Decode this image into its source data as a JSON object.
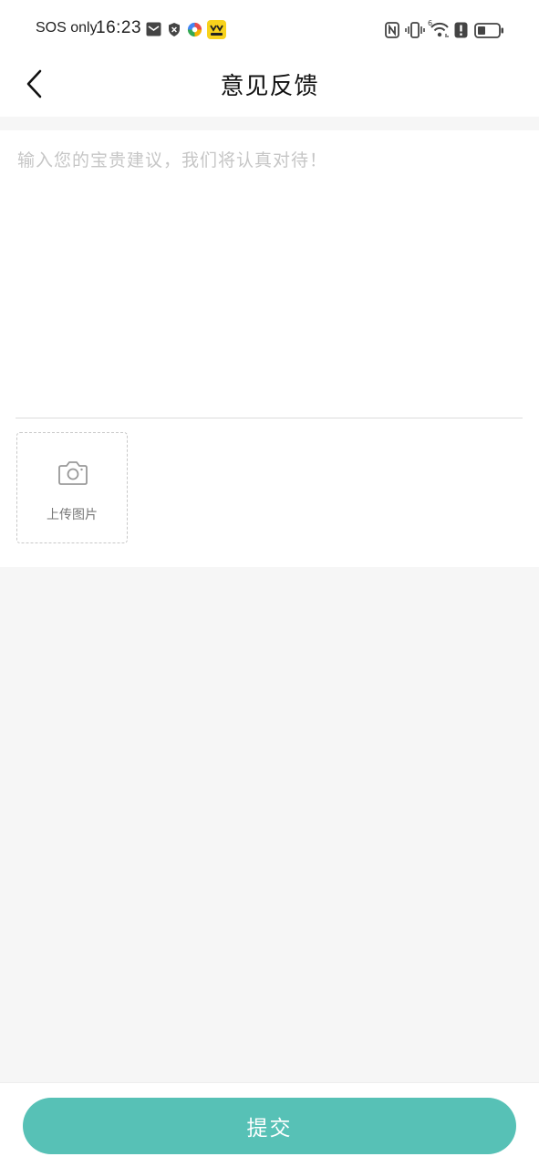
{
  "status_bar": {
    "carrier": "SOS only",
    "time": "16:23",
    "icons": [
      "mail-icon",
      "shield-icon",
      "colorful-app-icon",
      "yellow-app-icon",
      "nfc-icon",
      "vibrate-icon",
      "wifi-icon",
      "alert-icon",
      "battery-icon"
    ],
    "wifi_badge": "6"
  },
  "header": {
    "title": "意见反馈",
    "back_icon": "chevron-left-icon"
  },
  "feedback": {
    "placeholder": "输入您的宝贵建议，我们将认真对待！",
    "value": "",
    "upload_label": "上传图片",
    "upload_icon": "camera-icon"
  },
  "footer": {
    "submit_label": "提交"
  },
  "colors": {
    "accent": "#57c1b6",
    "background": "#f6f6f6",
    "placeholder": "#c6c6c6"
  }
}
